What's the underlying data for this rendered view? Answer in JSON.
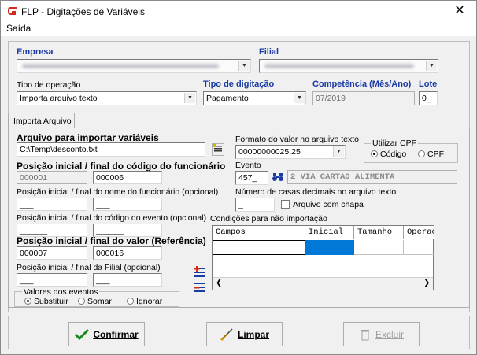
{
  "window": {
    "title": "FLP - Digitações de Variáveis",
    "close_glyph": "✕"
  },
  "menu": {
    "items": [
      "Saída"
    ]
  },
  "header": {
    "empresa_label": "Empresa",
    "filial_label": "Filial",
    "tipo_operacao_label": "Tipo de operação",
    "tipo_operacao_value": "Importa arquivo texto",
    "tipo_digitacao_label": "Tipo de digitação",
    "tipo_digitacao_value": "Pagamento",
    "competencia_label": "Competência (Mês/Ano)",
    "competencia_value": "07/2019",
    "lote_label": "Lote",
    "lote_value": "0_"
  },
  "tab": {
    "label": "Importa Arquivo"
  },
  "form": {
    "arquivo_label": "Arquivo para importar variáveis",
    "arquivo_value": "C:\\Temp\\desconto.txt",
    "pos_funcionario_label": "Posição inicial / final do código do funcionário",
    "pos_funcionario_ini": "000001",
    "pos_funcionario_fim": "000006",
    "pos_nome_label": "Posição inicial / final do nome do funcionário (opcional)",
    "pos_nome_ini": "___",
    "pos_nome_fim": "___",
    "pos_evento_label": "Posição inicial / final do código do evento (opcional)",
    "pos_evento_ini": "______",
    "pos_evento_fim": "______",
    "pos_valor_label": "Posição inicial / final do valor (Referência)",
    "pos_valor_ini": "000007",
    "pos_valor_fim": "000016",
    "pos_filial_label": "Posição inicial / final da Filial  (opcional)",
    "pos_filial_ini": "___",
    "pos_filial_fim": "___",
    "valores_eventos_label": "Valores dos eventos",
    "valores_eventos_options": [
      "Substituir",
      "Somar",
      "Ignorar"
    ],
    "formato_label": "Formato do valor no arquivo texto",
    "formato_value": "00000000025,25",
    "utilizar_cpf_label": "Utilizar CPF",
    "utilizar_cpf_options": [
      "Código",
      "CPF"
    ],
    "evento_label": "Evento",
    "evento_code": "457_",
    "evento_desc": "2 VIA  CARTAO ALIMENTA",
    "casas_decimais_label": "Número de casas decimais no arquivo texto",
    "casas_decimais_value": "_",
    "arquivo_chapa_label": "Arquivo com chapa",
    "condicoes_label": "Condições para não importação",
    "grid_columns": [
      "Campos",
      "Inicial",
      "Tamanho",
      "Operac"
    ]
  },
  "buttons": {
    "confirmar": "Confirmar",
    "limpar": "Limpar",
    "excluir": "Excluir"
  },
  "colors": {
    "accent_blue": "#1a3aa5",
    "selected_cell": "#0078d7",
    "app_icon_red": "#d42a1c"
  }
}
